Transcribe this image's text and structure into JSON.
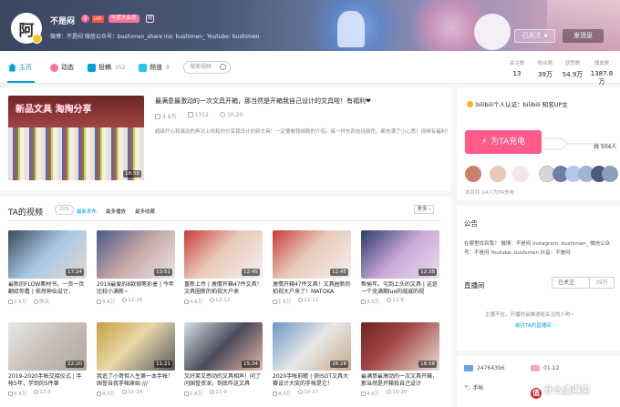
{
  "header": {
    "avatar_char": "阿",
    "username": "不是闷",
    "lv": "LV6",
    "vip": "年度大会员",
    "vip_icon": "勋",
    "sign": "微博：不是闷 微信公众号：bushimen_share ins: bushimen_ Youtube: bushimen",
    "follow_btn": "已关注",
    "message_btn": "发消息"
  },
  "nav": {
    "items": [
      {
        "label": "主页",
        "count": ""
      },
      {
        "label": "动态",
        "count": ""
      },
      {
        "label": "投稿",
        "count": "352"
      },
      {
        "label": "频道",
        "count": "8"
      }
    ],
    "search_placeholder": "搜索视频",
    "stats": [
      {
        "label": "关注数",
        "value": "13"
      },
      {
        "label": "粉丝数",
        "value": "39万"
      },
      {
        "label": "获赞数",
        "value": "54.9万"
      },
      {
        "label": "播放数",
        "value": "1387.8万"
      }
    ]
  },
  "featured": {
    "thumb_caption": "新品文具  淘掏分享",
    "duration": "18:58",
    "title": "最满意最激动的一次文具开箱，那当然是开箱我自己设计的文具啦！有福利❤",
    "plays": "4.6万",
    "comments": "1312",
    "date": "10-20",
    "desc": "超级开心和激动的再次上线和你分享我设计的新文具！一定要看我细致的介绍。每一样东西包括颜色，都充满了小心思！视频有福利！"
  },
  "videos": {
    "title": "TA的视频",
    "count": "203",
    "tabs": [
      "最新发布",
      "最多播放",
      "最多收藏"
    ],
    "more": "更多",
    "list": [
      {
        "duration": "17:24",
        "title": "最新的FLOW素材书，一页一页翻给你看 | 依然神仙设计，",
        "plays": "2.5万",
        "date": "昨天"
      },
      {
        "duration": "13:51",
        "title": "2019最爱的8款钢笔彩墨 | 今年比较小满新~",
        "plays": "3.4万",
        "date": "12-16"
      },
      {
        "duration": "12:45",
        "title": "重新上传 | 激情开箱47件文具！文具圈新的拍视大户来",
        "plays": "4.6万",
        "date": "12-12"
      },
      {
        "duration": "12:45",
        "title": "激情开箱47件文具！文具圈新的拍视大户来了！MATOKA",
        "plays": "1.5万",
        "date": "12-11"
      },
      {
        "duration": "12:38",
        "title": "帮偷年。屯到上头的文具 | 这是一个充满期lue的戚戚的视",
        "plays": "3.5万",
        "date": "12-9"
      },
      {
        "duration": "22:20",
        "title": "2019-2020手帐交接仪式 | 手帐5年，学到的5件事",
        "plays": "6.4万",
        "date": "12-5"
      },
      {
        "duration": "11:21",
        "title": "我追了小哥但人生第一本手帐！国誉自我手帐原始 ///",
        "plays": "8.3万",
        "date": "11-24"
      },
      {
        "duration": "15:34",
        "title": "又好笑又感动的文具相声！问了问国誉资深，到底咋这文具",
        "plays": "2.6万",
        "date": "11-9"
      },
      {
        "duration": "26:28",
        "title": "2020手帐前瞻 | 获ISOT文具大赛设计大奖的手帐是它！",
        "plays": "8.3万",
        "date": "10-27"
      },
      {
        "duration": "18:58",
        "title": "最满意最激动的一次文具开箱，那当然是开箱我自己设计",
        "plays": "4.6万",
        "date": "10-20"
      }
    ]
  },
  "side": {
    "verify": "bilibili个人认证：bilibili 知名UP主",
    "charge_btn": "为TA充电",
    "charge_count": "共 504人",
    "fans_note": "本月共 14人为TA充电",
    "announce_title": "公告",
    "announce_text": "在哪里找到我？ 微博：不是闷 Instagram: bushimen_ 微信公众号：不是闷 Youtube: bushimen 抖音：不是闷",
    "live_title": "直播间",
    "live_follow": "已关注",
    "live_count": "39万",
    "live_off": "主播不在，开播时会推送给关注的人哟~",
    "live_link": "前往TA的直播间",
    "uid": "24764396",
    "birthday": "01-12",
    "tags": "手帐"
  },
  "watermark": "什么值得买",
  "colors": {
    "accent": "#00a1d6",
    "pink": "#fb7299",
    "charge": "#ff5a8a"
  }
}
